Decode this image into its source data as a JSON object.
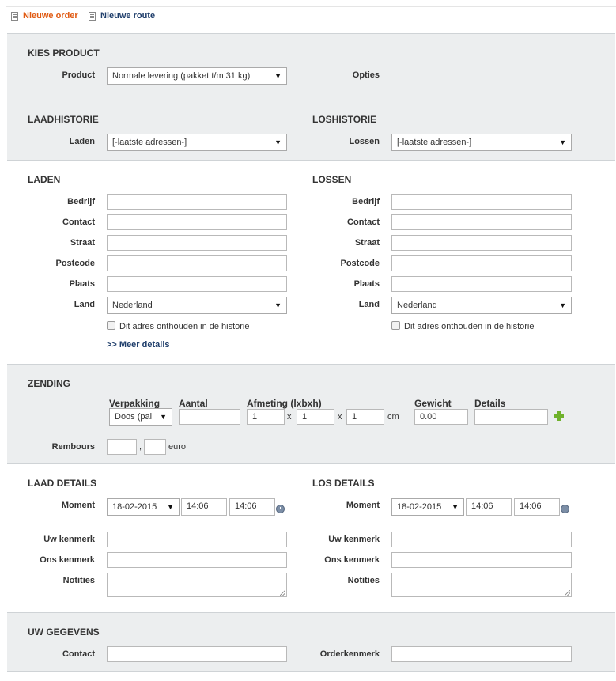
{
  "topbar": {
    "new_order": "Nieuwe order",
    "new_route": "Nieuwe route"
  },
  "kies_product": {
    "title": "KIES PRODUCT",
    "product_label": "Product",
    "product_value": "Normale levering (pakket t/m 31 kg)",
    "options_label": "Opties"
  },
  "history": {
    "laad_title": "LAADHISTORIE",
    "los_title": "LOSHISTORIE",
    "laden_label": "Laden",
    "laden_value": "[-laatste adressen-]",
    "lossen_label": "Lossen",
    "lossen_value": "[-laatste adressen-]"
  },
  "addresses": {
    "laden_title": "LADEN",
    "lossen_title": "LOSSEN",
    "fields": [
      "Bedrijf",
      "Contact",
      "Straat",
      "Postcode",
      "Plaats"
    ],
    "land_label": "Land",
    "land_value_laden": "Nederland",
    "land_value_lossen": "Nederland",
    "remember": "Dit adres onthouden in de historie",
    "more": ">> Meer details"
  },
  "zending": {
    "title": "ZENDING",
    "col_verpakking": "Verpakking",
    "col_aantal": "Aantal",
    "col_afmeting": "Afmeting (lxbxh)",
    "col_gewicht": "Gewicht",
    "col_details": "Details",
    "verpakking_value": "Doos (pal",
    "l": "1",
    "b": "1",
    "h": "1",
    "x1": "x",
    "x2": "x",
    "cm": "cm",
    "gewicht": "0.00",
    "rembours_label": "Rembours",
    "comma": ",",
    "euro": "euro"
  },
  "details": {
    "laad_title": "LAAD DETAILS",
    "los_title": "LOS DETAILS",
    "moment_label": "Moment",
    "laad_date": "18-02-2015",
    "laad_from": "14:06",
    "laad_to": "14:06",
    "los_date": "18-02-2015",
    "los_from": "14:06",
    "los_to": "14:06",
    "uw_kenmerk": "Uw kenmerk",
    "ons_kenmerk": "Ons kenmerk",
    "notities": "Notities"
  },
  "gegevens": {
    "title": "UW GEGEVENS",
    "contact_label": "Contact",
    "order_label": "Orderkenmerk"
  }
}
